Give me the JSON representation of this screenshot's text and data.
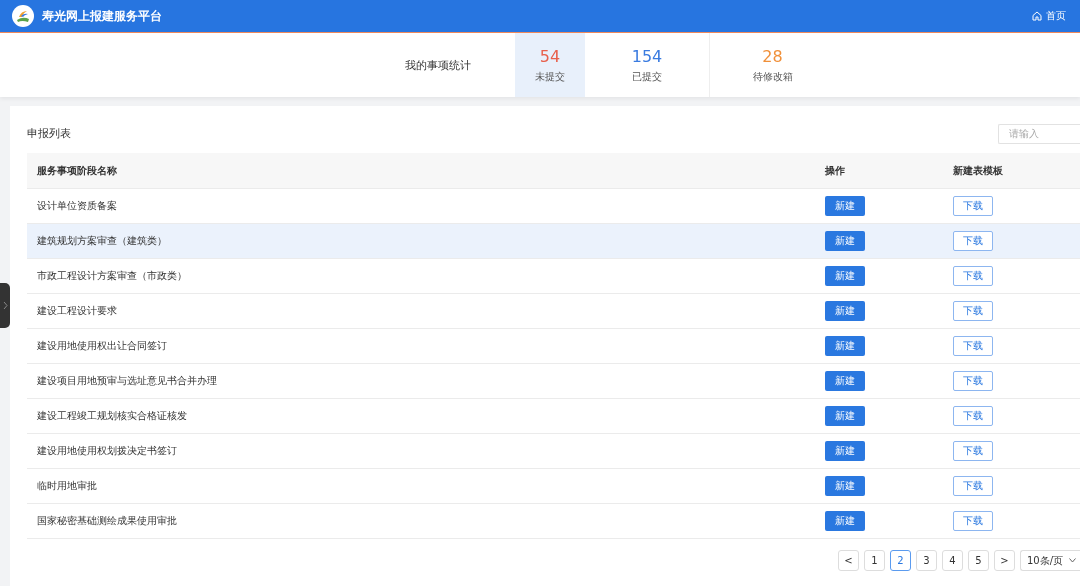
{
  "header": {
    "title": "寿光网上报建服务平台",
    "home_link": "首页"
  },
  "stats": {
    "label": "我的事项统计",
    "items": [
      {
        "value": "54",
        "label": "未提交",
        "color": "#e8604c",
        "selected": true
      },
      {
        "value": "154",
        "label": "已提交",
        "color": "#3a7be0",
        "selected": false
      },
      {
        "value": "28",
        "label": "待修改箱",
        "color": "#f0903a",
        "selected": false
      }
    ]
  },
  "list": {
    "title": "申报列表",
    "search": {
      "placeholder": "请输入"
    },
    "columns": [
      "服务事项阶段名称",
      "操作",
      "新建表模板"
    ],
    "rows": [
      {
        "name": "设计单位资质备案",
        "action": "新建",
        "template": "下载",
        "selected": false
      },
      {
        "name": "建筑规划方案审查（建筑类）",
        "action": "新建",
        "template": "下载",
        "selected": true
      },
      {
        "name": "市政工程设计方案审查（市政类）",
        "action": "新建",
        "template": "下载",
        "selected": false
      },
      {
        "name": "建设工程设计要求",
        "action": "新建",
        "template": "下载",
        "selected": false
      },
      {
        "name": "建设用地使用权出让合同签订",
        "action": "新建",
        "template": "下载",
        "selected": false
      },
      {
        "name": "建设项目用地预审与选址意见书合并办理",
        "action": "新建",
        "template": "下载",
        "selected": false
      },
      {
        "name": "建设工程竣工规划核实合格证核发",
        "action": "新建",
        "template": "下载",
        "selected": false
      },
      {
        "name": "建设用地使用权划拨决定书签订",
        "action": "新建",
        "template": "下载",
        "selected": false
      },
      {
        "name": "临时用地审批",
        "action": "新建",
        "template": "下载",
        "selected": false
      },
      {
        "name": "国家秘密基础测绘成果使用审批",
        "action": "新建",
        "template": "下载",
        "selected": false
      }
    ]
  },
  "pagination": {
    "prev": "<",
    "next": ">",
    "page_size": "10条/页",
    "pages": [
      {
        "label": "1",
        "selected": false
      },
      {
        "label": "2",
        "selected": true
      },
      {
        "label": "3",
        "selected": false
      },
      {
        "label": "4",
        "selected": false
      },
      {
        "label": "5",
        "selected": false
      }
    ]
  }
}
